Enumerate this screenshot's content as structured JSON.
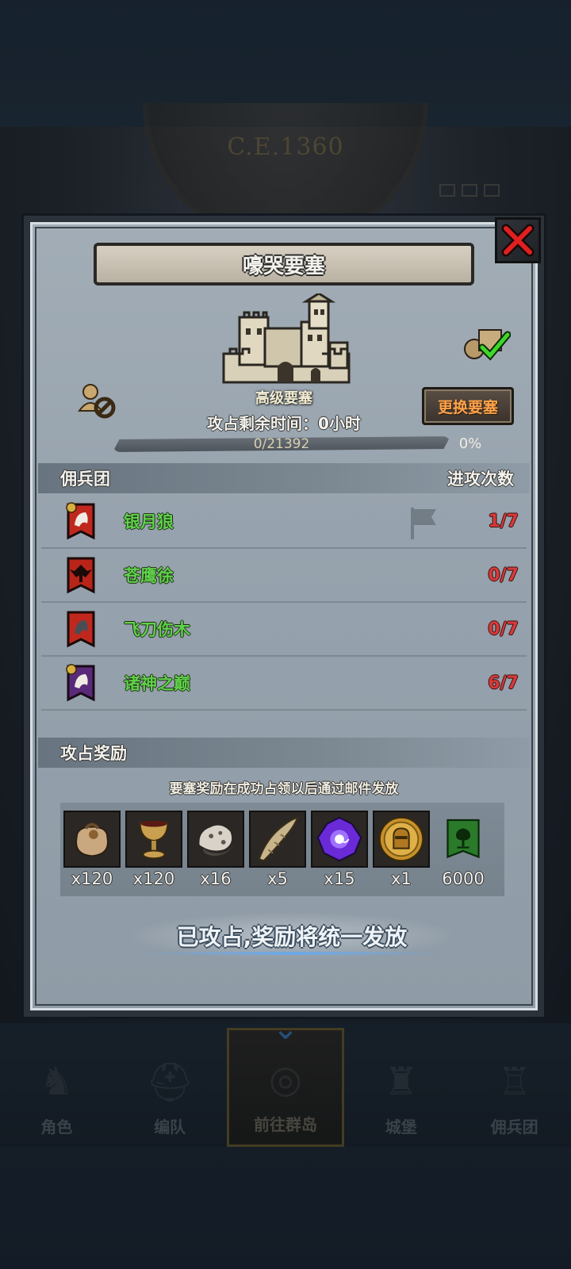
{
  "background": {
    "era": "C.E.1360"
  },
  "modal": {
    "title": "嚎哭要塞",
    "fortress_type": "高级要塞",
    "change_button": "更换要塞",
    "remaining_time_label": "攻占剩余时间：",
    "remaining_time_value": "0小时",
    "progress_text": "0/21392",
    "progress_percent": "0%",
    "progress_fraction": 0,
    "mercenary_header": "佣兵团",
    "attack_count_header": "进攻次数",
    "mercenaries": [
      {
        "name": "银月狼",
        "count": "1/7",
        "banner_color": "#c0281e",
        "emblem": "wolf-emblem-icon"
      },
      {
        "name": "苍鹰徐",
        "count": "0/7",
        "banner_color": "#b82418",
        "emblem": "eagle-emblem-icon"
      },
      {
        "name": "飞刀伤木",
        "count": "0/7",
        "banner_color": "#c0281e",
        "emblem": "wolf-emblem-icon"
      },
      {
        "name": "诸神之巅",
        "count": "6/7",
        "banner_color": "#5a2a7a",
        "emblem": "wolf-emblem-icon"
      }
    ],
    "reward_header": "攻占奖励",
    "reward_note": "要塞奖励在成功占领以后通过邮件发放",
    "rewards": [
      {
        "icon": "sack-icon",
        "qty": "x120"
      },
      {
        "icon": "goblet-icon",
        "qty": "x120"
      },
      {
        "icon": "ore-icon",
        "qty": "x16"
      },
      {
        "icon": "horn-icon",
        "qty": "x5"
      },
      {
        "icon": "purple-gem-icon",
        "qty": "x15"
      },
      {
        "icon": "gold-medal-icon",
        "qty": "x1"
      },
      {
        "icon": "guild-banner-icon",
        "qty": "6000"
      }
    ],
    "occupied_message": "已攻占,奖励将统一发放"
  },
  "bottom_nav": [
    {
      "label": "角色",
      "active": false
    },
    {
      "label": "编队",
      "active": false
    },
    {
      "label": "前往群岛",
      "active": true
    },
    {
      "label": "城堡",
      "active": false
    },
    {
      "label": "佣兵团",
      "active": false
    }
  ],
  "colors": {
    "merc_name": "#5fd14a",
    "attack_count": "#d63a3a",
    "change_button_text": "#ffa24a"
  }
}
